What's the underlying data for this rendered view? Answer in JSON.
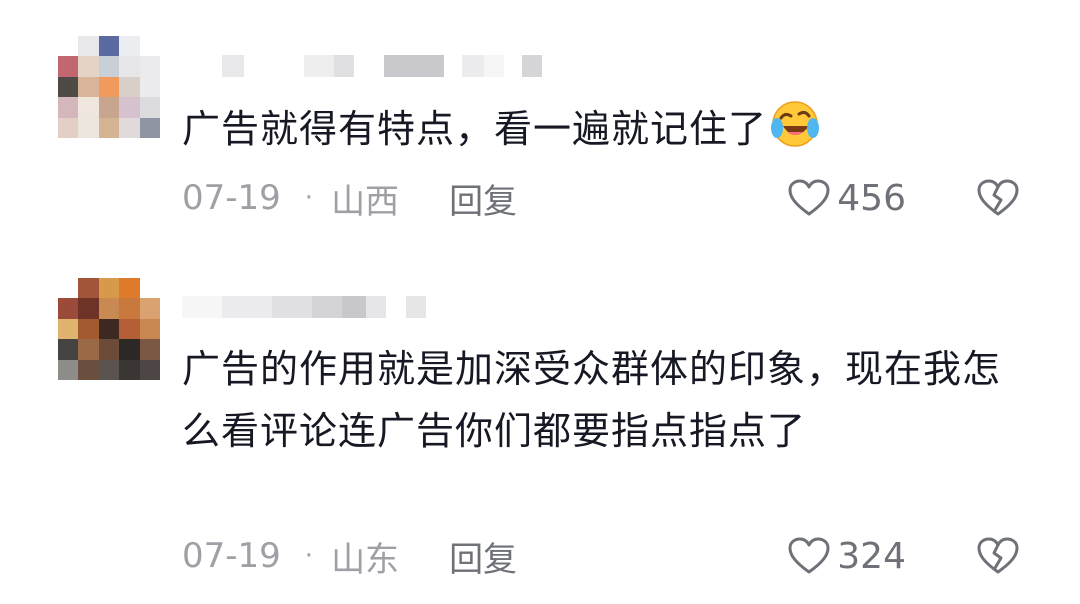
{
  "comments": [
    {
      "text": "广告就得有特点，看一遍就记住了",
      "date": "07-19",
      "separator": "·",
      "location": "山西",
      "reply_label": "回复",
      "like_count": "456",
      "emoji": "laughing-crying-emoji"
    },
    {
      "text": "广告的作用就是加深受众群体的印象，现在我怎么看评论连广告你们都要指点指点了",
      "date": "07-19",
      "separator": "·",
      "location": "山东",
      "reply_label": "回复",
      "like_count": "324"
    }
  ],
  "colors": {
    "text": "#161823",
    "meta": "#9ea0a6",
    "icon": "#6f7178"
  }
}
